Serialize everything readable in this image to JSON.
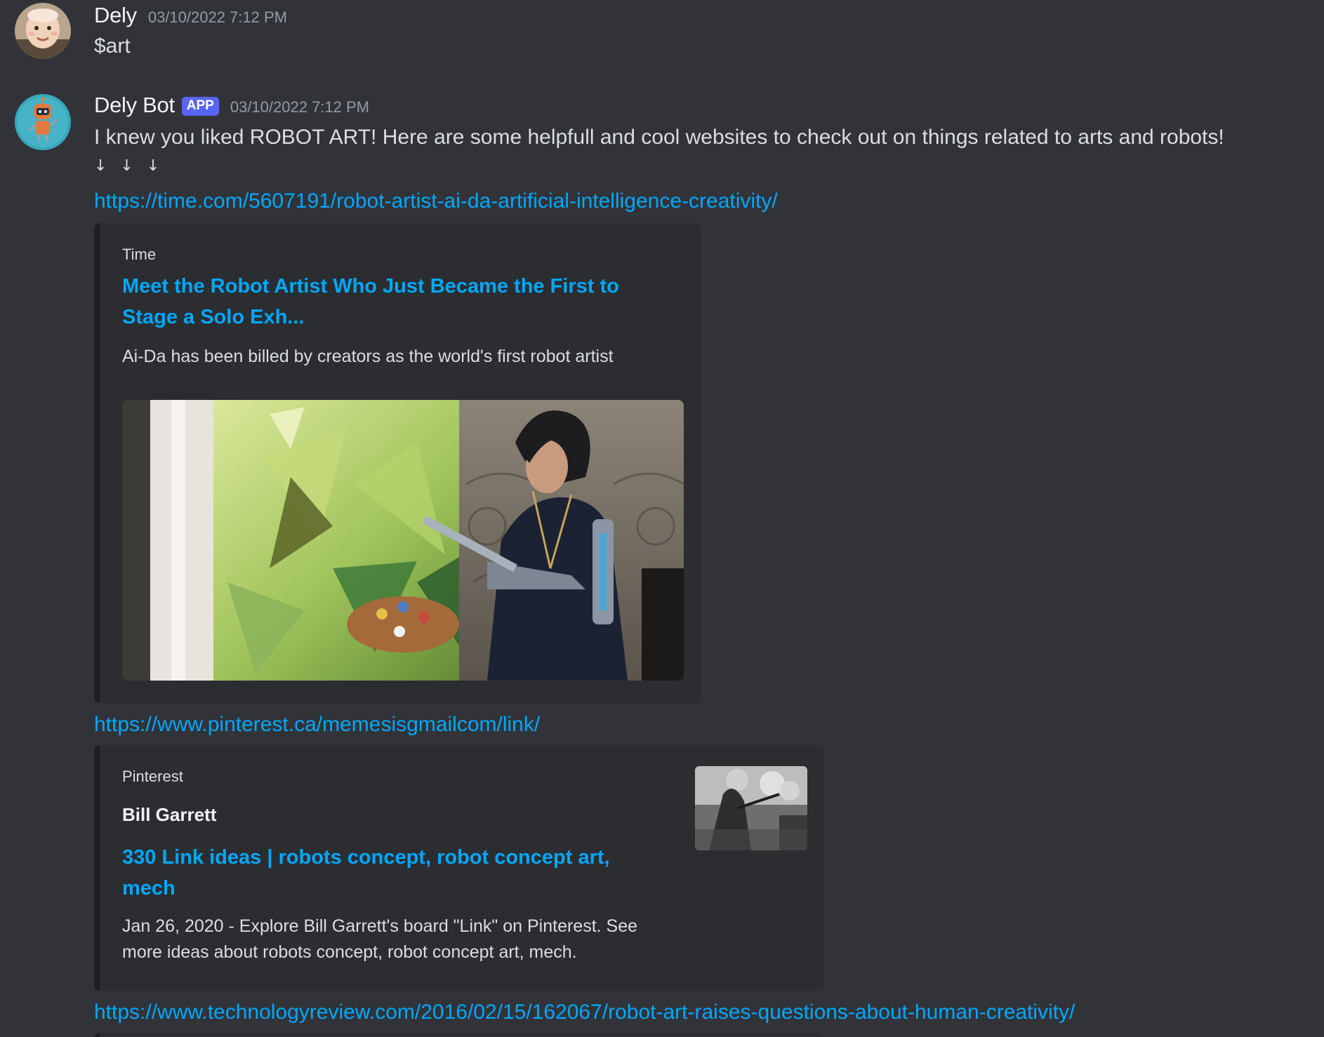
{
  "messages": [
    {
      "username": "Dely",
      "timestamp": "03/10/2022 7:12 PM",
      "content": "$art",
      "avatar": "user-avatar"
    },
    {
      "username": "Dely Bot",
      "badge": "APP",
      "timestamp": "03/10/2022 7:12 PM",
      "content": "I knew you liked ROBOT ART! Here are some helpfull and cool websites to check out on things related to arts and robots!",
      "arrows": "↓ ↓ ↓",
      "avatar": "bot-avatar",
      "links": [
        {
          "url": "https://time.com/5607191/robot-artist-ai-da-artificial-intelligence-creativity/",
          "embed": {
            "provider": "Time",
            "title": "Meet the Robot Artist Who Just Became the First to Stage a Solo Exh...",
            "title_line1": "Meet the Robot Artist Who Just Became the First to",
            "title_line2": "Stage a Solo Exh...",
            "description": "Ai-Da has been billed by creators as the world's first robot artist",
            "image": "robot-artist-photo"
          }
        },
        {
          "url": "https://www.pinterest.ca/memesisgmailcom/link/",
          "embed": {
            "provider": "Pinterest",
            "author": "Bill Garrett",
            "title": "330 Link ideas | robots concept, robot concept art, mech",
            "title_line1": "330 Link ideas | robots concept, robot concept art,",
            "title_line2": "mech",
            "description_line1": "Jan 26, 2020 - Explore Bill Garrett's board \"Link\" on Pinterest. See",
            "description_line2": "more ideas about robots concept, robot concept art, mech.",
            "thumbnail": "pinterest-thumbnail"
          }
        },
        {
          "url": "https://www.technologyreview.com/2016/02/15/162067/robot-art-raises-questions-about-human-creativity/"
        }
      ]
    }
  ],
  "colors": {
    "background": "#313338",
    "embed_background": "#2b2d31",
    "link": "#00a8fc",
    "app_badge": "#5865f2",
    "timestamp": "#949ba4"
  }
}
